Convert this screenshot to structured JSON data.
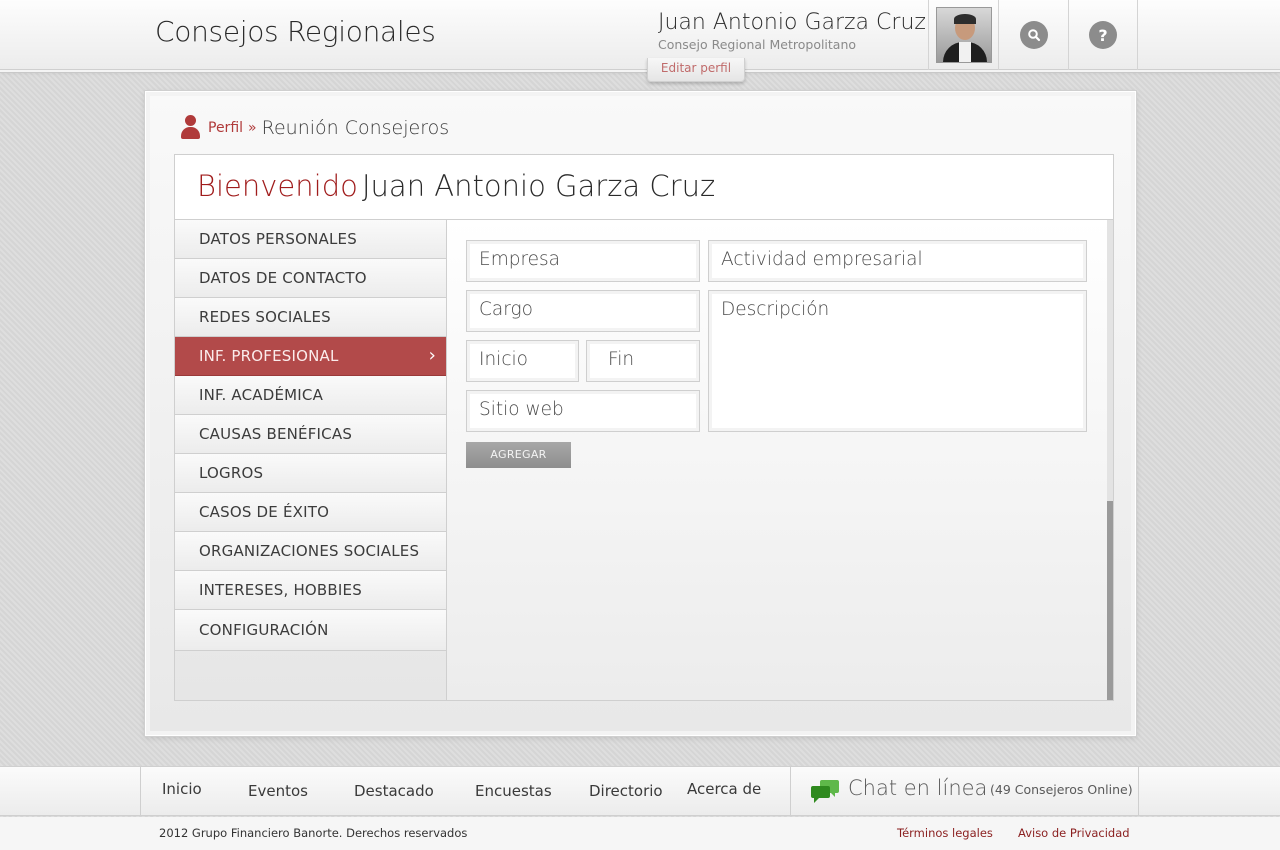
{
  "header": {
    "app_title": "Consejos Regionales",
    "user_name": "Juan Antonio Garza Cruz",
    "user_council": "Consejo Regional Metropolitano",
    "edit_profile_label": "Editar perfil",
    "search_icon": "search-icon",
    "help_icon": "help-icon",
    "help_glyph": "?"
  },
  "breadcrumb": {
    "link": "Perfil",
    "separator": "»",
    "current": "Reunión Consejeros"
  },
  "welcome": {
    "word": "Bienvenido",
    "name": "Juan Antonio Garza Cruz"
  },
  "menu": {
    "items": [
      {
        "label": "DATOS PERSONALES"
      },
      {
        "label": "DATOS DE CONTACTO"
      },
      {
        "label": "REDES SOCIALES"
      },
      {
        "label": "INF. PROFESIONAL",
        "active": true
      },
      {
        "label": "INF. ACADÉMICA"
      },
      {
        "label": "CAUSAS BENÉFICAS"
      },
      {
        "label": "LOGROS"
      },
      {
        "label": "CASOS DE ÉXITO"
      },
      {
        "label": "ORGANIZACIONES SOCIALES"
      },
      {
        "label": "INTERESES, HOBBIES"
      },
      {
        "label": "CONFIGURACIÓN"
      }
    ],
    "active_chevron": "›"
  },
  "form": {
    "empresa_placeholder": "Empresa",
    "actividad_placeholder": "Actividad empresarial",
    "cargo_placeholder": "Cargo",
    "descripcion_placeholder": "Descripción",
    "inicio_placeholder": "Inicio",
    "fin_placeholder": "Fin",
    "sitio_placeholder": "Sitio web",
    "add_button": "AGREGAR"
  },
  "footer": {
    "nav": [
      "Inicio",
      "Eventos",
      "Destacado",
      "Encuestas",
      "Directorio",
      "Acerca de"
    ],
    "chat_label": "Chat en línea",
    "chat_count": "(49 Consejeros Online)",
    "copyright": "2012 Grupo Financiero Banorte. Derechos reservados",
    "legal": "Términos legales",
    "privacy": "Aviso de Privacidad"
  },
  "colors": {
    "accent": "#b24a4a",
    "accent_text": "#a01c1c",
    "chat_icon": "#3a9a2a"
  }
}
